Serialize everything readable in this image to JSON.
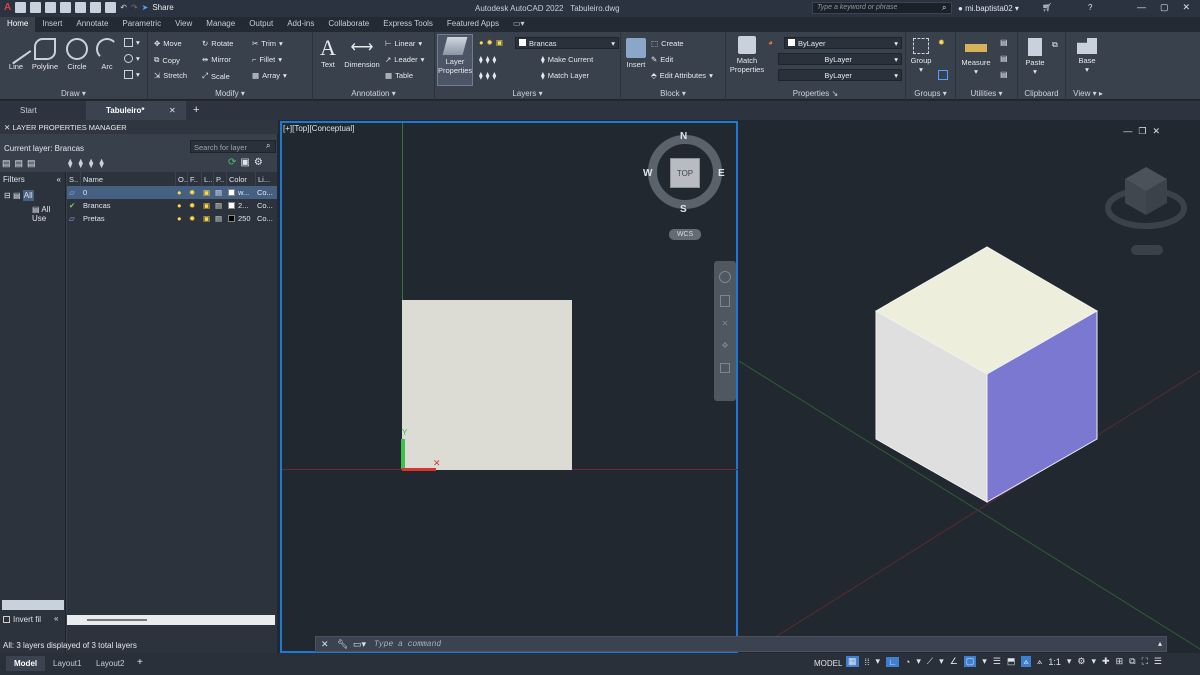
{
  "app": {
    "title": "Autodesk AutoCAD 2022",
    "filename": "Tabuleiro.dwg",
    "share_label": "Share",
    "search_placeholder": "Type a keyword or phrase",
    "user": "mi.baptista02"
  },
  "ribbon_tabs": [
    "Home",
    "Insert",
    "Annotate",
    "Parametric",
    "View",
    "Manage",
    "Output",
    "Add-ins",
    "Collaborate",
    "Express Tools",
    "Featured Apps"
  ],
  "ribbon": {
    "draw": {
      "title": "Draw",
      "line": "Line",
      "polyline": "Polyline",
      "circle": "Circle",
      "arc": "Arc"
    },
    "modify": {
      "title": "Modify",
      "move": "Move",
      "rotate": "Rotate",
      "trim": "Trim",
      "copy": "Copy",
      "mirror": "Mirror",
      "fillet": "Fillet",
      "stretch": "Stretch",
      "scale": "Scale",
      "array": "Array"
    },
    "annotation": {
      "title": "Annotation",
      "text": "Text",
      "dimension": "Dimension",
      "linear": "Linear",
      "leader": "Leader",
      "table": "Table"
    },
    "layers": {
      "title": "Layers",
      "layer_properties": "Layer Properties",
      "current_layer": "Brancas",
      "make_current": "Make Current",
      "match_layer": "Match Layer"
    },
    "block": {
      "title": "Block",
      "insert": "Insert",
      "create": "Create",
      "edit": "Edit",
      "edit_attributes": "Edit Attributes"
    },
    "properties": {
      "title": "Properties",
      "match_properties": "Match Properties",
      "color": "ByLayer",
      "linetype": "ByLayer",
      "lineweight": "ByLayer"
    },
    "groups": {
      "title": "Groups",
      "group": "Group"
    },
    "utilities": {
      "title": "Utilities",
      "measure": "Measure"
    },
    "clipboard": {
      "title": "Clipboard",
      "paste": "Paste"
    },
    "view": {
      "title": "View",
      "base": "Base"
    }
  },
  "file_tabs": [
    "Start",
    "Tabuleiro*"
  ],
  "layer_manager": {
    "title": "LAYER PROPERTIES MANAGER",
    "current_layer": "Current layer: Brancas",
    "search_placeholder": "Search for layer",
    "filters_label": "Filters",
    "tree_all": "All",
    "tree_all_used": "All Use",
    "columns": [
      "S..",
      "Name",
      "O..",
      "F..",
      "L..",
      "P..",
      "Color",
      "Li..."
    ],
    "layers": [
      {
        "name": "0",
        "color": "w...",
        "color_hex": "#ffffff",
        "linetype": "Co..."
      },
      {
        "name": "Brancas",
        "color": "2...",
        "color_hex": "#ffffff",
        "linetype": "Co..."
      },
      {
        "name": "Pretas",
        "color": "250",
        "color_hex": "#000000",
        "linetype": "Co..."
      }
    ],
    "invert_filter": "Invert fil",
    "footer": "All: 3 layers displayed of 3 total layers"
  },
  "viewport_left": {
    "label": "[+][Top][Conceptual]",
    "compass": {
      "n": "N",
      "s": "S",
      "e": "E",
      "w": "W",
      "top": "TOP",
      "wcs": "WCS"
    },
    "axis_y": "Y"
  },
  "command": {
    "placeholder": "Type a command"
  },
  "layout_tabs": [
    "Model",
    "Layout1",
    "Layout2"
  ],
  "status": {
    "model": "MODEL",
    "scale": "1:1"
  },
  "colors": {
    "accent": "#1e78d8",
    "cube_top": "#eeeedd",
    "cube_left": "#dfdfe0",
    "cube_right": "#7a78d0",
    "square": "#dcdcd4"
  }
}
